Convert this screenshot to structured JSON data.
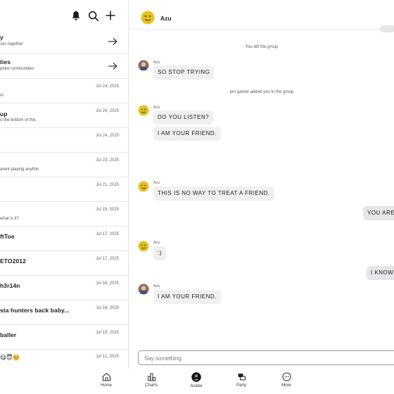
{
  "left_panel": {
    "header_icons": [
      "bell-icon",
      "search-icon",
      "plus-icon"
    ],
    "promos": [
      {
        "title": "y",
        "subtitle": "ces together"
      },
      {
        "title": "ties",
        "subtitle": "plore communities"
      }
    ],
    "conversations": [
      {
        "title": "",
        "preview": "m",
        "date": "Jul 24, 2025"
      },
      {
        "title": "up",
        "preview": "o the bottom of this",
        "date": "Jul 24, 2025"
      },
      {
        "title": "",
        "preview": "",
        "date": "Jul 24, 2025"
      },
      {
        "title": "",
        "preview": "arent playing anythin",
        "date": "Jul 23, 2025"
      },
      {
        "title": "",
        "preview": "",
        "date": "Jul 21, 2025"
      },
      {
        "title": "",
        "preview": "what is it?",
        "date": "Jul 19, 2025"
      },
      {
        "title": "ftToe",
        "preview": "",
        "date": "Jul 17, 2025"
      },
      {
        "title": "ETO2012",
        "preview": "",
        "date": "Jul 17, 2025"
      },
      {
        "title": "h3r14n",
        "preview": "",
        "date": "Jul 16, 2025"
      },
      {
        "title": "sta hunters back baby...",
        "preview": "",
        "date": "Jul 16, 2025"
      },
      {
        "title": "baller",
        "preview": "",
        "date": "Jul 15, 2025"
      },
      {
        "title": "😋😇🥺",
        "preview": "",
        "date": "Jul 12, 2025"
      }
    ]
  },
  "chat": {
    "name": "Azu",
    "messages": {
      "sys1": "You left the group",
      "sender1": "Azu",
      "msg1": "SO STOP TRYING",
      "sys2": "pro gamer added you to the group",
      "sender2": "Azu",
      "msg2": "DO YOU LISTEN?",
      "msg3": "I AM YOUR FRIEND.",
      "sender3": "Azu",
      "msg4": "THIS IS NO WAY TO TREAT A FRIEND.",
      "out1": "YOU ARE",
      "sender4": "Azu",
      "msg5": ":)",
      "out2": "I KNOW",
      "sender5": "Azu",
      "msg6": "I AM YOUR FRIEND."
    },
    "input_placeholder": "Say something"
  },
  "bottom_nav": [
    {
      "label": "Home",
      "icon": "home-icon"
    },
    {
      "label": "Charts",
      "icon": "charts-icon"
    },
    {
      "label": "Avatar",
      "icon": "avatar-icon"
    },
    {
      "label": "Party",
      "icon": "party-icon"
    },
    {
      "label": "More",
      "icon": "more-icon"
    }
  ],
  "colors": {
    "bubble": "#f0f0f0",
    "outgoing_bubble": "#e5e6e8",
    "avatar_yellow": "#e4c21d",
    "divider": "#e4e4e4"
  }
}
